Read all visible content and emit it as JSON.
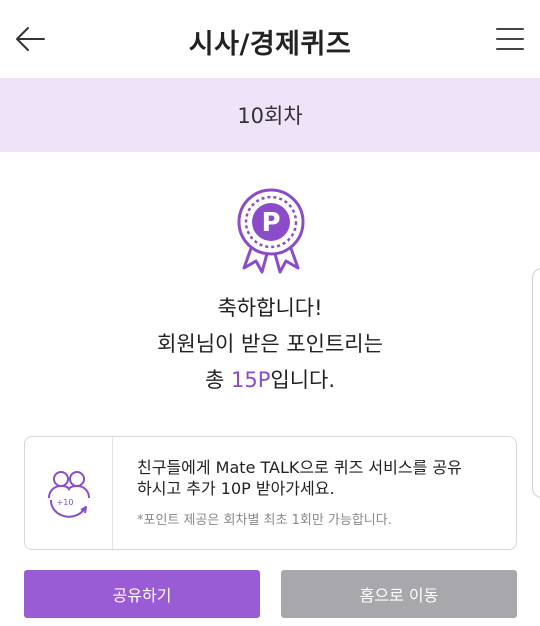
{
  "header": {
    "title": "시사/경제퀴즈",
    "back_icon": "arrow-left-icon",
    "menu_icon": "hamburger-menu-icon"
  },
  "round": {
    "label": "10회차"
  },
  "badge": {
    "icon": "point-award-medal-icon",
    "letter": "P"
  },
  "result": {
    "line1": "축하합니다!",
    "line2": "회원님이 받은 포인트리는",
    "line3_prefix": "총 ",
    "points": "15P",
    "line3_suffix": "입니다."
  },
  "share_card": {
    "icon": "friends-plus10-icon",
    "icon_text": "+10",
    "line1": "친구들에게 Mate TALK으로 퀴즈 서비스를 공유",
    "line2": "하시고 추가 10P 받아가세요.",
    "note": "*포인트 제공은 회차별 최초 1회만 가능합니다."
  },
  "buttons": {
    "share_label": "공유하기",
    "home_label": "홈으로 이동"
  },
  "colors": {
    "accent": "#9a5cd4",
    "points_text": "#8a4cc8",
    "round_bar_bg": "#efe3fa",
    "home_button_bg": "#a8a8ac"
  }
}
